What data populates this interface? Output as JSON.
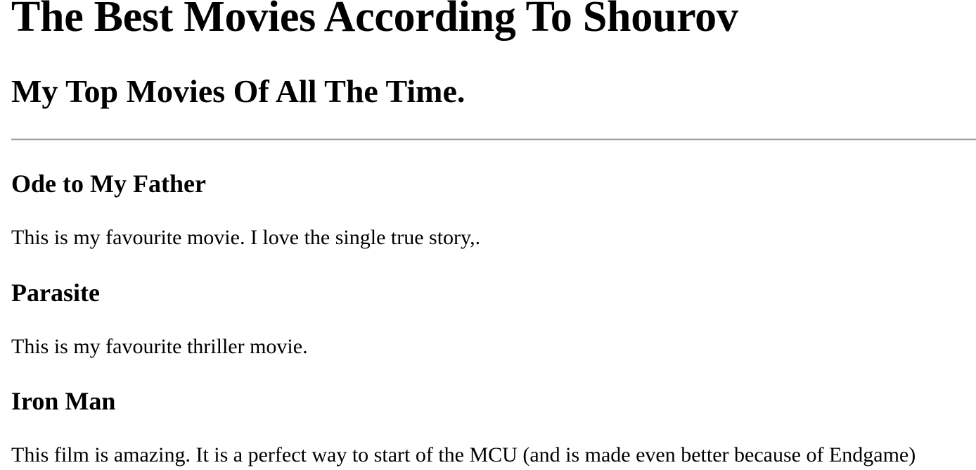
{
  "page": {
    "title": "The Best Movies According To Shourov",
    "subtitle": "My Top Movies Of All The Time."
  },
  "movies": [
    {
      "name": "Ode to My Father",
      "description": "This is my favourite movie. I love the single true story,."
    },
    {
      "name": "Parasite",
      "description": "This is my favourite thriller movie."
    },
    {
      "name": "Iron Man",
      "description": "This film is amazing. It is a perfect way to start of the MCU (and is made even better because of Endgame)"
    }
  ]
}
